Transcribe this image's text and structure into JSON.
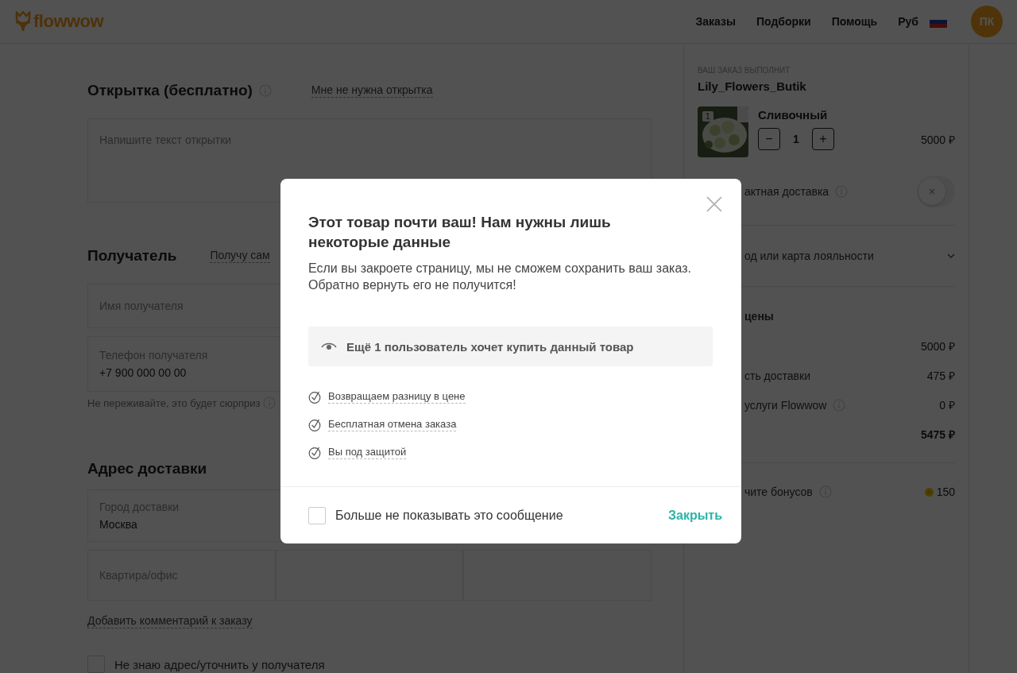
{
  "header": {
    "logo": "flowwow",
    "nav": [
      "Заказы",
      "Подборки",
      "Помощь"
    ],
    "currency": "Руб",
    "avatar": "ПК"
  },
  "form": {
    "card": {
      "title": "Открытка (бесплатно)",
      "link": "Мне не нужна открытка",
      "placeholder": "Напишите текст открытки"
    },
    "recipient": {
      "title": "Получатель",
      "link": "Получу сам",
      "fields": [
        {
          "label": "Имя получателя"
        },
        {
          "label": "Телефон получателя",
          "value": "+7 900 000 00 00"
        }
      ],
      "note": "Не переживайте, это будет сюрприз"
    },
    "address": {
      "title": "Адрес доставки",
      "city": {
        "label": "Город доставки",
        "value": "Москва"
      },
      "parts": [
        {
          "label": "Квартира/офис"
        }
      ],
      "comment_link": "Добавить комментарий к заказу",
      "unknown": {
        "label": "Не знаю адрес/уточнить у получателя",
        "checked": false
      }
    }
  },
  "order": {
    "executor_label": "ВАШ ЗАКАЗ ВЫПОЛНИТ",
    "shop": "Lily_Flowers_Butik",
    "product": {
      "name": "Сливочный",
      "badge": "1",
      "minus": "−",
      "qty": "1",
      "plus": "+",
      "price": "5000 ₽"
    },
    "contactless": {
      "label": "актная доставка",
      "on": false
    },
    "promo": {
      "label": "од или карта лояльности"
    },
    "prices": {
      "title": "цены",
      "rows": [
        {
          "value": "5000 ₽",
          "info": false,
          "total": false
        },
        {
          "label": "сть доставки",
          "value": "475 ₽",
          "info": false,
          "total": false
        },
        {
          "label": "услуги Flowwow",
          "value": "0 ₽",
          "info": true,
          "total": false
        },
        {
          "value": "5475 ₽",
          "info": false,
          "total": true
        }
      ]
    },
    "bonus": {
      "label": "чите бонусов",
      "value": "150"
    }
  },
  "modal": {
    "title": "Этот товар почти ваш! Нам нужны лишь некоторые данные",
    "text": "Если вы закроете страницу, мы не сможем сохранить ваш заказ. Обратно вернуть его не получится!",
    "alert": "Ещё 1 пользователь хочет купить данный товар",
    "benefits": [
      "Возвращаем разницу в цене",
      "Бесплатная отмена заказа",
      "Вы под защитой"
    ],
    "dont_show": {
      "label": "Больше не показывать это сообщение",
      "checked": false
    },
    "close_button": "Закрыть"
  }
}
